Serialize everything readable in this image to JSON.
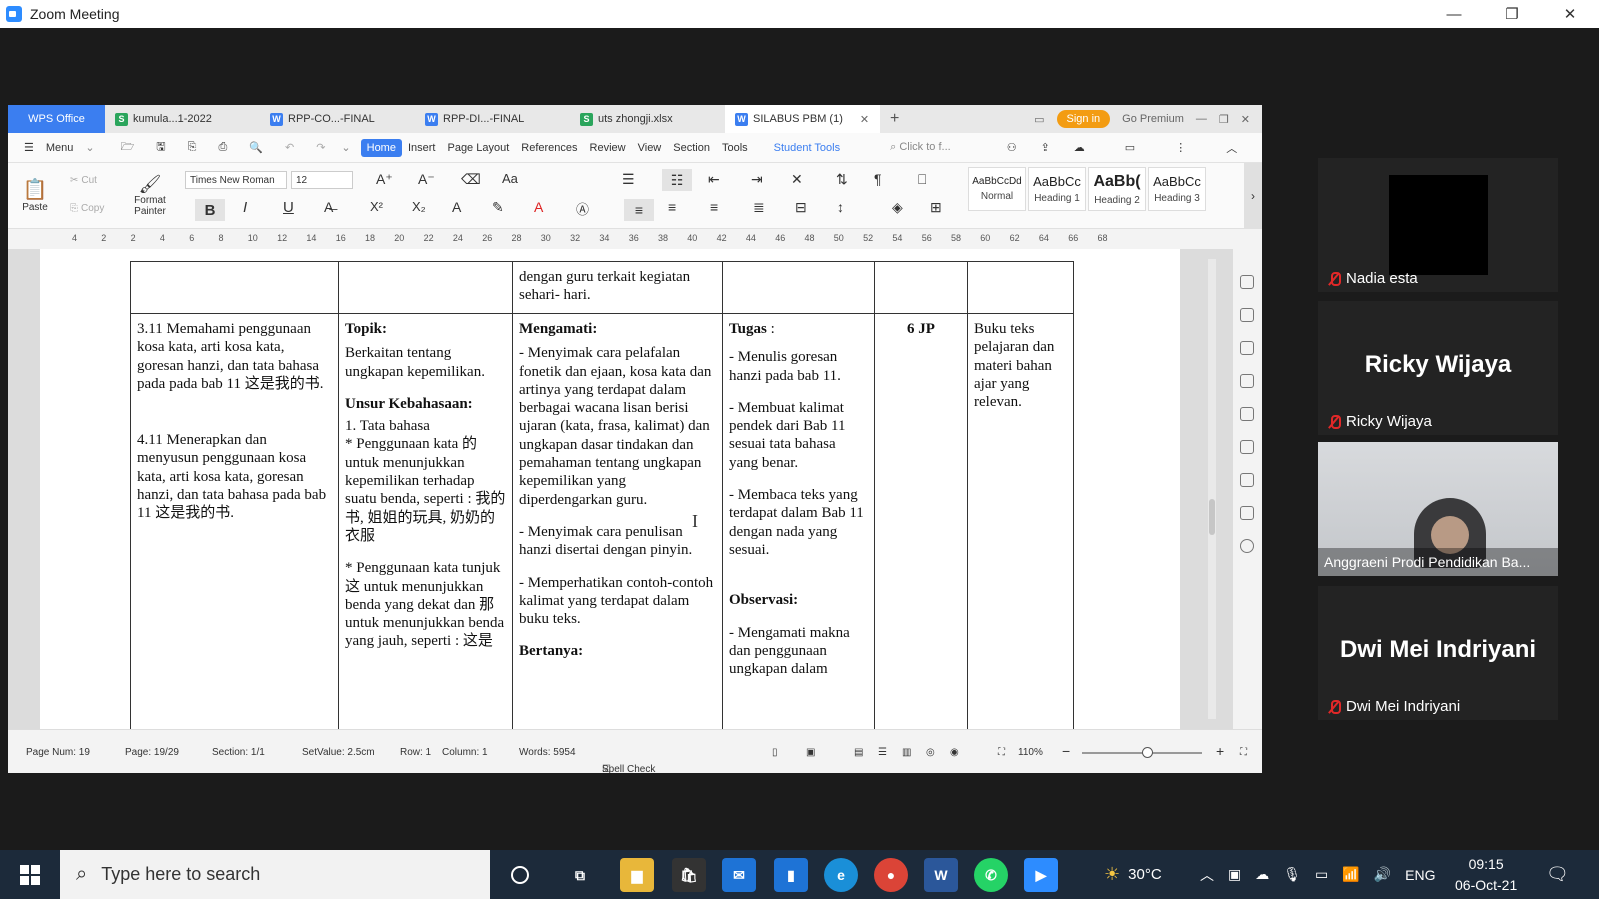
{
  "zoom": {
    "title": "Zoom Meeting",
    "min": "—",
    "restore": "❐",
    "close": "✕"
  },
  "wps": {
    "brand": "WPS Office",
    "tabs": [
      {
        "label": "kumula...1-2022",
        "type": "S"
      },
      {
        "label": "RPP-CO...-FINAL",
        "type": "W"
      },
      {
        "label": "RPP-DI...-FINAL",
        "type": "W"
      },
      {
        "label": "uts zhongji.xlsx",
        "type": "S"
      },
      {
        "label": "SILABUS PBM (1)",
        "type": "W"
      }
    ],
    "sign_in": "Sign in",
    "go_premium": "Go Premium",
    "menu": {
      "menu_label": "Menu",
      "items": [
        "Home",
        "Insert",
        "Page Layout",
        "References",
        "Review",
        "View",
        "Section",
        "Tools"
      ],
      "student_tools": "Student Tools",
      "search_placeholder": "Click to f..."
    },
    "ribbon": {
      "paste": "Paste",
      "cut": "Cut",
      "copy": "Copy",
      "format_painter": "Format Painter",
      "font_name": "Times New Roman",
      "font_size": "12",
      "styles": [
        {
          "preview": "AaBbCcDd",
          "name": "Normal"
        },
        {
          "preview": "AaBbCc",
          "name": "Heading 1"
        },
        {
          "preview": "AaBb(",
          "name": "Heading 2"
        },
        {
          "preview": "AaBbCc",
          "name": "Heading 3"
        }
      ]
    },
    "ruler_ticks": [
      "4",
      "2",
      "2",
      "4",
      "6",
      "8",
      "10",
      "12",
      "14",
      "16",
      "18",
      "20",
      "22",
      "24",
      "26",
      "28",
      "30",
      "32",
      "34",
      "36",
      "38",
      "40",
      "42",
      "44",
      "46",
      "48",
      "50",
      "52",
      "54",
      "56",
      "58",
      "60",
      "62",
      "64",
      "66",
      "68"
    ],
    "table": {
      "row0_col3": "dengan guru terkait kegiatan sehari- hari.",
      "c1_kd1": "3.11  Memahami penggunaan kosa kata, arti kosa kata, goresan  hanzi, dan tata bahasa pada pada bab 11 这是我的书.",
      "c1_kd2": "4.11 Menerapkan dan menyusun penggunaan kosa kata, arti kosa kata, goresan hanzi, dan tata bahasa pada bab 11 这是我的书.",
      "c2_topik_h": "Topik:",
      "c2_topik": "Berkaitan tentang ungkapan kepemilikan.",
      "c2_unsur_h": "Unsur Kebahasaan:",
      "c2_tata": "1. Tata bahasa",
      "c2_p1": "* Penggunaan kata 的 untuk menunjukkan kepemilikan terhadap suatu benda, seperti : 我的书, 姐姐的玩具, 奶奶的衣服",
      "c2_p2": "* Penggunaan kata tunjuk 这 untuk menunjukkan benda yang dekat dan 那 untuk menunjukkan benda yang jauh, seperti : 这是",
      "c3_h": "Mengamati:",
      "c3_p1": "- Menyimak cara pelafalan fonetik dan ejaan, kosa kata dan artinya yang terdapat dalam berbagai wacana lisan berisi  ujaran (kata, frasa, kalimat) dan ungkapan dasar tindakan dan pemahaman tentang ungkapan kepemilikan yang diperdengarkan guru.",
      "c3_p2": "- Menyimak cara penulisan hanzi disertai dengan pinyin.",
      "c3_p3": "- Memperhatikan contoh-contoh kalimat yang terdapat dalam buku teks.",
      "c3_h2": "Bertanya:",
      "c4_h": "Tugas",
      "c4_colon": " :",
      "c4_p1": "- Menulis goresan hanzi pada bab 11.",
      "c4_p2": "- Membuat kalimat pendek dari Bab 11 sesuai tata bahasa yang benar.",
      "c4_p3": "- Membaca teks yang terdapat dalam Bab 11 dengan nada yang sesuai.",
      "c4_h2": "Observasi:",
      "c4_p4": "- Mengamati makna dan penggunaan ungkapan dalam",
      "c5": "6 JP",
      "c6": "Buku teks pelajaran dan materi bahan ajar yang relevan."
    },
    "status": {
      "page_num": "Page Num: 19",
      "page": "Page: 19/29",
      "section": "Section: 1/1",
      "setvalue": "SetValue: 2.5cm",
      "row": "Row: 1",
      "column": "Column: 1",
      "words": "Words: 5954",
      "spell": "Spell Check",
      "zoom": "110%"
    }
  },
  "participants": [
    {
      "name": "Nadia esta",
      "big": ""
    },
    {
      "name": "Ricky Wijaya",
      "big": "Ricky Wijaya"
    },
    {
      "name": "Anggraeni Prodi Pendidikan Ba...",
      "big": ""
    },
    {
      "name": "Dwi Mei Indriyani",
      "big": "Dwi Mei Indriyani"
    }
  ],
  "taskbar": {
    "search_placeholder": "Type here to search",
    "weather": "30°C",
    "lang": "ENG",
    "time": "09:15",
    "date": "06-Oct-21"
  }
}
